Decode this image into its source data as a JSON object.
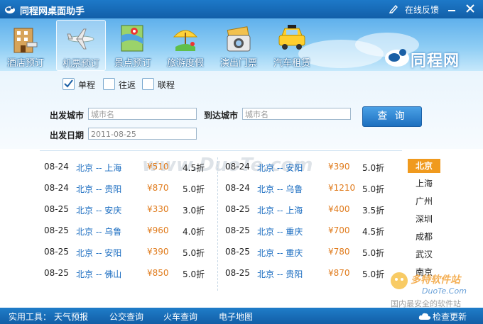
{
  "app": {
    "title": "同程网桌面助手",
    "feedback_label": "在线反馈",
    "brand_text": "同程网"
  },
  "toolbar": {
    "items": [
      {
        "label": "酒店预订",
        "icon": "hotel-icon"
      },
      {
        "label": "机票预订",
        "icon": "airplane-icon",
        "active": true
      },
      {
        "label": "景点预订",
        "icon": "map-icon"
      },
      {
        "label": "旅游度假",
        "icon": "beach-icon"
      },
      {
        "label": "演出门票",
        "icon": "ticket-icon"
      },
      {
        "label": "汽车租赁",
        "icon": "taxi-icon"
      }
    ]
  },
  "trip_type": {
    "options": [
      {
        "label": "单程",
        "checked": true
      },
      {
        "label": "往返",
        "checked": false
      },
      {
        "label": "联程",
        "checked": false
      }
    ]
  },
  "search": {
    "from_label": "出发城市",
    "from_placeholder": "城市名",
    "to_label": "到达城市",
    "to_placeholder": "城市名",
    "date_label": "出发日期",
    "date_value": "2011-08-25",
    "button_label": "查 询"
  },
  "deals": {
    "left": [
      {
        "date": "08-24",
        "route": "北京 -- 上海",
        "price": "¥510",
        "discount": "4.5折"
      },
      {
        "date": "08-24",
        "route": "北京 -- 贵阳",
        "price": "¥870",
        "discount": "5.0折"
      },
      {
        "date": "08-25",
        "route": "北京 -- 安庆",
        "price": "¥330",
        "discount": "3.0折"
      },
      {
        "date": "08-25",
        "route": "北京 -- 乌鲁",
        "price": "¥960",
        "discount": "4.0折"
      },
      {
        "date": "08-25",
        "route": "北京 -- 安阳",
        "price": "¥390",
        "discount": "5.0折"
      },
      {
        "date": "08-25",
        "route": "北京 -- 佛山",
        "price": "¥850",
        "discount": "5.0折"
      }
    ],
    "right": [
      {
        "date": "08-24",
        "route": "北京 -- 安阳",
        "price": "¥390",
        "discount": "5.0折"
      },
      {
        "date": "08-24",
        "route": "北京 -- 乌鲁",
        "price": "¥1210",
        "discount": "5.0折"
      },
      {
        "date": "08-25",
        "route": "北京 -- 上海",
        "price": "¥400",
        "discount": "3.5折"
      },
      {
        "date": "08-25",
        "route": "北京 -- 重庆",
        "price": "¥700",
        "discount": "4.5折"
      },
      {
        "date": "08-25",
        "route": "北京 -- 重庆",
        "price": "¥780",
        "discount": "5.0折"
      },
      {
        "date": "08-25",
        "route": "北京 -- 贵阳",
        "price": "¥870",
        "discount": "5.0折"
      }
    ]
  },
  "cities": {
    "items": [
      "北京",
      "上海",
      "广州",
      "深圳",
      "成都",
      "武汉",
      "南京"
    ],
    "active_index": 0
  },
  "watermark": {
    "main": "www.DuoTe.com",
    "badge_title": "多特软件站",
    "badge_url": "DuoTe.Com",
    "badge_slogan": "国内最安全的软件站"
  },
  "status_bar": {
    "tools_label": "实用工具：",
    "links": [
      "天气预报",
      "公交查询",
      "火车查询",
      "电子地图"
    ],
    "update_label": "检查更新"
  },
  "colors": {
    "accent": "#1d79c8",
    "price": "#e07b1c",
    "route": "#1a6cc0",
    "active_city": "#f09a1e"
  }
}
